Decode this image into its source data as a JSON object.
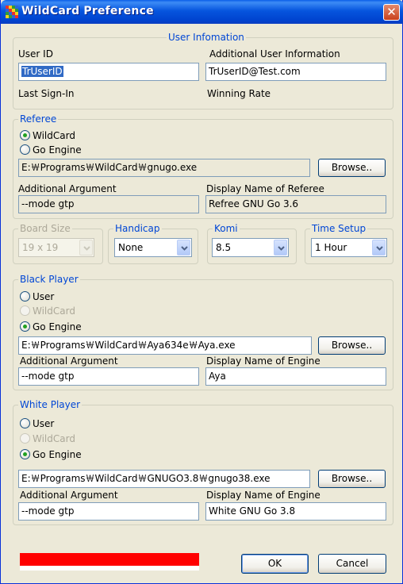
{
  "window": {
    "title": "WildCard Preference",
    "close_glyph": "✕"
  },
  "colors": {
    "title_bar": "#0a5fe8",
    "legend": "#0046d5",
    "progress_fill": "#ff0000",
    "radio_dot": "#21a121"
  },
  "user_info": {
    "legend": "User Infomation",
    "user_id_label": "User ID",
    "user_id_value": "TrUserID",
    "additional_label": "Additional User Information",
    "additional_value": "TrUserID@Test.com",
    "last_signin_label": "Last Sign-In",
    "winning_rate_label": "Winning Rate"
  },
  "referee": {
    "legend": "Referee",
    "opt_wildcard": "WildCard",
    "opt_go_engine": "Go Engine",
    "path": "E:￦Programs￦WildCard￦gnugo.exe",
    "browse": "Browse..",
    "arg_label": "Additional Argument",
    "arg_value": "--mode gtp",
    "display_label": "Display Name of Referee",
    "display_value": "Refree GNU Go 3.6"
  },
  "settings": {
    "board_size": {
      "legend": "Board Size",
      "value": "19 x 19"
    },
    "handicap": {
      "legend": "Handicap",
      "value": "None"
    },
    "komi": {
      "legend": "Komi",
      "value": "8.5"
    },
    "time_setup": {
      "legend": "Time Setup",
      "value": "1 Hour"
    }
  },
  "black": {
    "legend": "Black Player",
    "opt_user": "User",
    "opt_wildcard": "WildCard",
    "opt_go_engine": "Go Engine",
    "path": "E:￦Programs￦WildCard￦Aya634e￦Aya.exe",
    "browse": "Browse..",
    "arg_label": "Additional Argument",
    "arg_value": "--mode gtp",
    "display_label": "Display Name of Engine",
    "display_value": "Aya"
  },
  "white": {
    "legend": "White Player",
    "opt_user": "User",
    "opt_wildcard": "WildCard",
    "opt_go_engine": "Go Engine",
    "path": "E:￦Programs￦WildCard￦GNUGO3.8￦gnugo38.exe",
    "browse": "Browse..",
    "arg_label": "Additional Argument",
    "arg_value": "--mode gtp",
    "display_label": "Display Name of Engine",
    "display_value": "White GNU Go 3.8"
  },
  "footer": {
    "progress": 1.0,
    "ok": "OK",
    "cancel": "Cancel"
  }
}
